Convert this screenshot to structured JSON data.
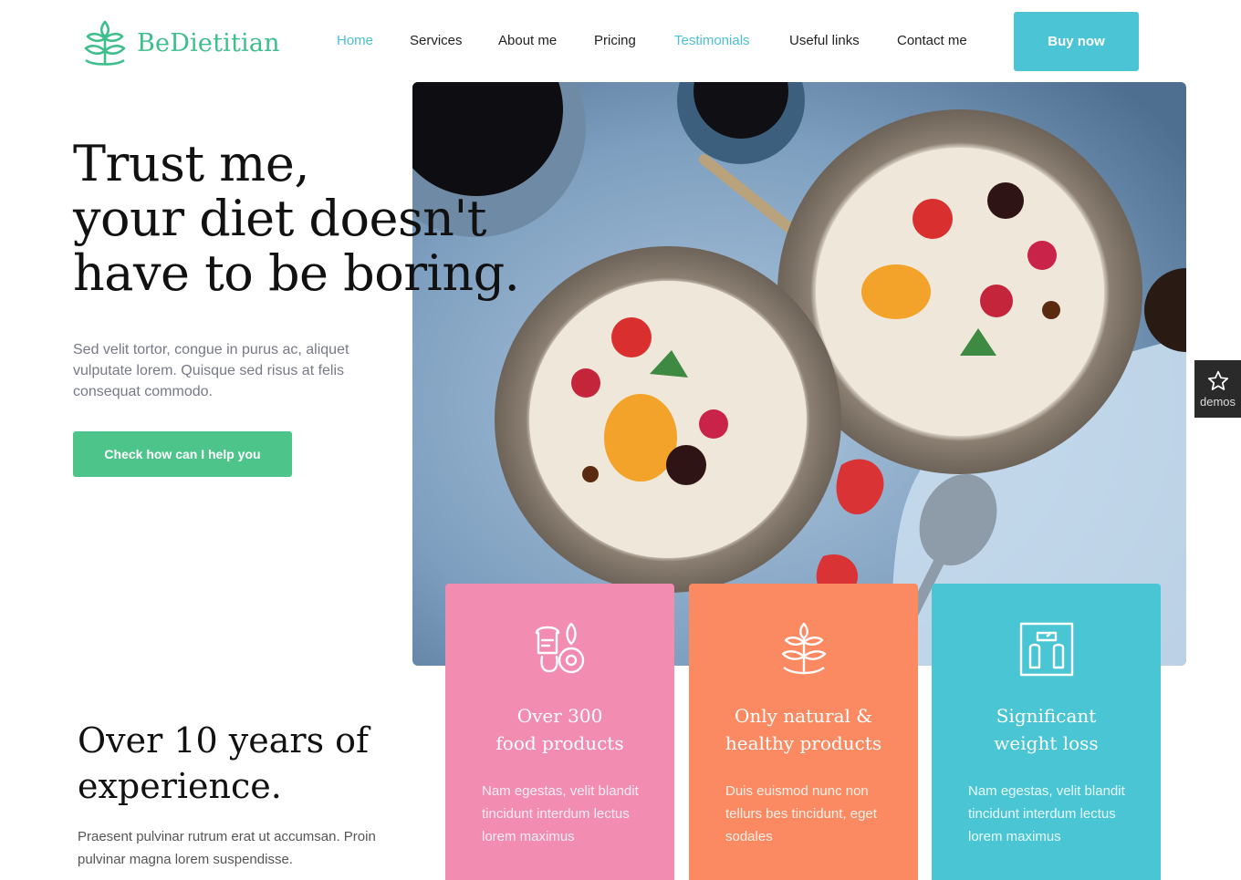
{
  "brand": {
    "name": "BeDietitian",
    "color": "#3dbe8b"
  },
  "nav": {
    "items": [
      "Home",
      "Services",
      "About me",
      "Pricing",
      "Testimonials",
      "Useful links",
      "Contact me"
    ],
    "active_color": "#4bbfd4"
  },
  "header": {
    "buy_label": "Buy now",
    "buy_color": "#4bc4d5"
  },
  "hero": {
    "title_lines": [
      "Trust me,",
      "your diet doesn't",
      "have to be boring."
    ],
    "description": "Sed velit tortor, congue in purus ac, aliquet vulputate lorem. Quisque sed risus at felis consequat commodo.",
    "cta_label": "Check how can I help you",
    "cta_color": "#4cc48a",
    "image_icon": "fruit-porridge-bowls-photo"
  },
  "demos": {
    "label": "demos",
    "icon": "star-icon"
  },
  "experience": {
    "title_lines": [
      "Over 10 years of",
      "experience."
    ],
    "description": "Praesent pulvinar rutrum erat ut accumsan. Proin pulvinar magna lorem suspendisse."
  },
  "features": [
    {
      "icon": "food-products-icon",
      "title_lines": [
        "Over 300",
        "food products"
      ],
      "text": "Nam egestas, velit blandit tincidunt interdum lectus lorem maximus",
      "color": "#f28cb1"
    },
    {
      "icon": "plant-leaf-icon",
      "title_lines": [
        "Only natural &",
        "healthy products"
      ],
      "text": "Duis euismod nunc non tellurs bes tincidunt, eget sodales",
      "color": "#fb8a63"
    },
    {
      "icon": "weight-scale-icon",
      "title_lines": [
        "Significant",
        "weight loss"
      ],
      "text": "Nam egestas, velit blandit tincidunt interdum lectus lorem maximus",
      "color": "#49c5d4"
    }
  ]
}
